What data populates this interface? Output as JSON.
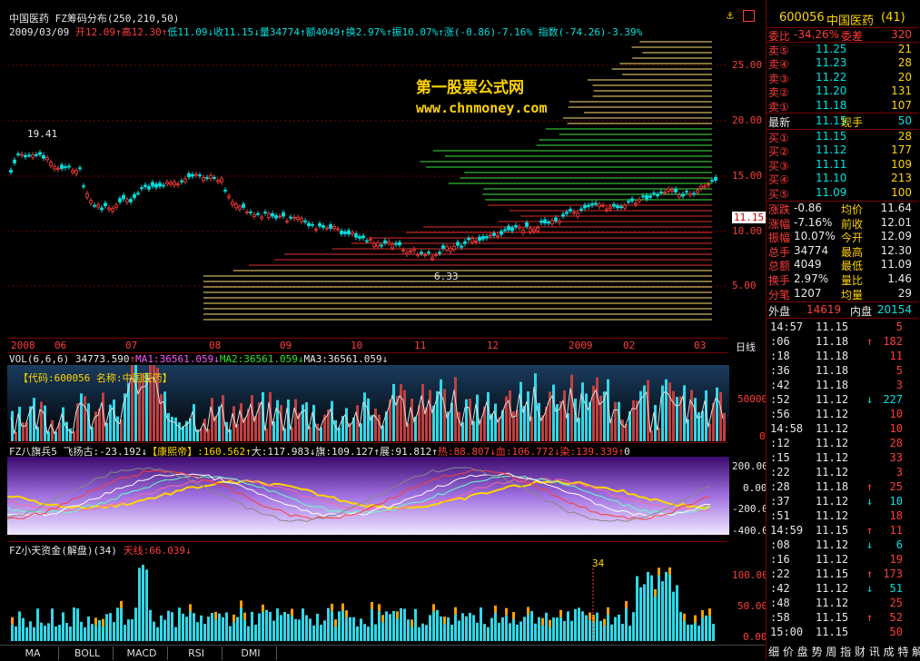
{
  "colors": {
    "up": "#ff3c3c",
    "down": "#2ee62e",
    "cyan": "#00e0e0",
    "yellow": "#ffd400",
    "border": "#7a0000"
  },
  "header": {
    "stock_name": "中国医药",
    "indicator": "FZ筹码分布",
    "params": "(250,210,50)",
    "date": "2009/03/09",
    "open_label": "开",
    "open": "12.09",
    "high_label": "高",
    "high": "12.30",
    "low_label": "低",
    "low": "11.09",
    "close_label": "收",
    "close": "11.15",
    "vol_label": "量",
    "vol": "34774",
    "amt_label": "额",
    "amt": "4049",
    "turn_label": "换",
    "turn": "2.97%",
    "amp_label": "振",
    "amp": "10.07%",
    "chg": "涨(-0.86)-7.16%",
    "index": "指数(-74.26)-3.39%"
  },
  "watermark": {
    "line1": "第一股票公式网",
    "line2": "www.chnmoney.com"
  },
  "price_axis": [
    "25.00",
    "20.00",
    "15.00",
    "10.00",
    "5.00"
  ],
  "price_annotations": {
    "high": "19.41",
    "low": "6.33",
    "current": "11.15"
  },
  "time_axis": [
    "2008",
    "06",
    "07",
    "08",
    "09",
    "10",
    "11",
    "12",
    "2009",
    "02",
    "03"
  ],
  "period": "日线",
  "vol_pane": {
    "title": "VOL(6,6,6)",
    "vol": "34773.590",
    "ma1": "MA1:36561.059",
    "ma2": "MA2:36561.059",
    "ma3": "MA3:36561.059",
    "code_note": "【代码:600056 名称:中国医药】",
    "axis": [
      "50000",
      "0"
    ]
  },
  "flag_pane": {
    "title": "FZ八旗兵5",
    "items": [
      "飞扬古:-23.192",
      "【康熙帝】:160.562",
      "大:117.983",
      "旗:109.127",
      "展:91.812",
      "热:88.807",
      "血:106.772",
      "染:139.339",
      "0"
    ],
    "axis": [
      "200.00",
      "0.00",
      "-200.00",
      "-400.00"
    ]
  },
  "fund_pane": {
    "title": "FZ小天资金(解盘)(34)",
    "line": "天线:66.039",
    "marker": "34",
    "axis": [
      "100.00",
      "50.00",
      "0.00"
    ]
  },
  "tabs": [
    "MA",
    "BOLL",
    "MACD",
    "RSI",
    "DMI"
  ],
  "quote": {
    "code": "600056",
    "name": "中国医药",
    "count": "(41)",
    "weibi_label": "委比",
    "weibi": "-34.26%",
    "weicha_label": "委差",
    "weicha": "320",
    "sells": [
      {
        "l": "卖⑤",
        "p": "11.25",
        "v": "21"
      },
      {
        "l": "卖④",
        "p": "11.23",
        "v": "28"
      },
      {
        "l": "卖③",
        "p": "11.22",
        "v": "20"
      },
      {
        "l": "卖②",
        "p": "11.20",
        "v": "131"
      },
      {
        "l": "卖①",
        "p": "11.18",
        "v": "107"
      }
    ],
    "latest_label": "最新",
    "latest": "11.15",
    "xianshou_label": "现手",
    "xianshou": "50",
    "buys": [
      {
        "l": "买①",
        "p": "11.15",
        "v": "28"
      },
      {
        "l": "买②",
        "p": "11.12",
        "v": "177"
      },
      {
        "l": "买③",
        "p": "11.11",
        "v": "109"
      },
      {
        "l": "买④",
        "p": "11.10",
        "v": "213"
      },
      {
        "l": "买⑤",
        "p": "11.09",
        "v": "100"
      }
    ],
    "stats": [
      {
        "a": "涨跌",
        "b": "-0.86",
        "c": "均价",
        "d": "11.64"
      },
      {
        "a": "涨幅",
        "b": "-7.16%",
        "c": "前收",
        "d": "12.01"
      },
      {
        "a": "振幅",
        "b": "10.07%",
        "c": "今开",
        "d": "12.09"
      },
      {
        "a": "总手",
        "b": "34774",
        "c": "最高",
        "d": "12.30"
      },
      {
        "a": "总额",
        "b": "4049",
        "c": "最低",
        "d": "11.09"
      },
      {
        "a": "换手",
        "b": "2.97%",
        "c": "量比",
        "d": "1.46"
      },
      {
        "a": "分笔",
        "b": "1207",
        "c": "均量",
        "d": "29"
      }
    ],
    "waipan_label": "外盘",
    "waipan": "14619",
    "neipan_label": "内盘",
    "neipan": "20154"
  },
  "ticks": [
    {
      "t": "14:57",
      "p": "11.15",
      "a": "",
      "v": "5"
    },
    {
      "t": ":06",
      "p": "11.18",
      "a": "↑",
      "v": "182"
    },
    {
      "t": ":18",
      "p": "11.18",
      "a": "",
      "v": "11"
    },
    {
      "t": ":36",
      "p": "11.18",
      "a": "",
      "v": "5"
    },
    {
      "t": ":42",
      "p": "11.18",
      "a": "",
      "v": "3"
    },
    {
      "t": ":52",
      "p": "11.12",
      "a": "↓",
      "v": "227"
    },
    {
      "t": ":56",
      "p": "11.12",
      "a": "",
      "v": "10"
    },
    {
      "t": "14:58",
      "p": "11.12",
      "a": "",
      "v": "10"
    },
    {
      "t": ":12",
      "p": "11.12",
      "a": "",
      "v": "28"
    },
    {
      "t": ":15",
      "p": "11.12",
      "a": "",
      "v": "33"
    },
    {
      "t": ":22",
      "p": "11.12",
      "a": "",
      "v": "3"
    },
    {
      "t": ":28",
      "p": "11.18",
      "a": "↑",
      "v": "25"
    },
    {
      "t": ":37",
      "p": "11.12",
      "a": "↓",
      "v": "10"
    },
    {
      "t": ":51",
      "p": "11.12",
      "a": "",
      "v": "18"
    },
    {
      "t": "14:59",
      "p": "11.15",
      "a": "↑",
      "v": "11"
    },
    {
      "t": ":08",
      "p": "11.12",
      "a": "↓",
      "v": "6"
    },
    {
      "t": ":16",
      "p": "11.12",
      "a": "",
      "v": "19"
    },
    {
      "t": ":22",
      "p": "11.15",
      "a": "↑",
      "v": "173"
    },
    {
      "t": ":42",
      "p": "11.12",
      "a": "↓",
      "v": "51"
    },
    {
      "t": ":48",
      "p": "11.12",
      "a": "",
      "v": "25"
    },
    {
      "t": ":58",
      "p": "11.15",
      "a": "↑",
      "v": "52"
    },
    {
      "t": "15:00",
      "p": "11.15",
      "a": "",
      "v": "50"
    }
  ],
  "footer_tabs": "细 价 盘 势 周 指 财 讯 成 特 解"
}
